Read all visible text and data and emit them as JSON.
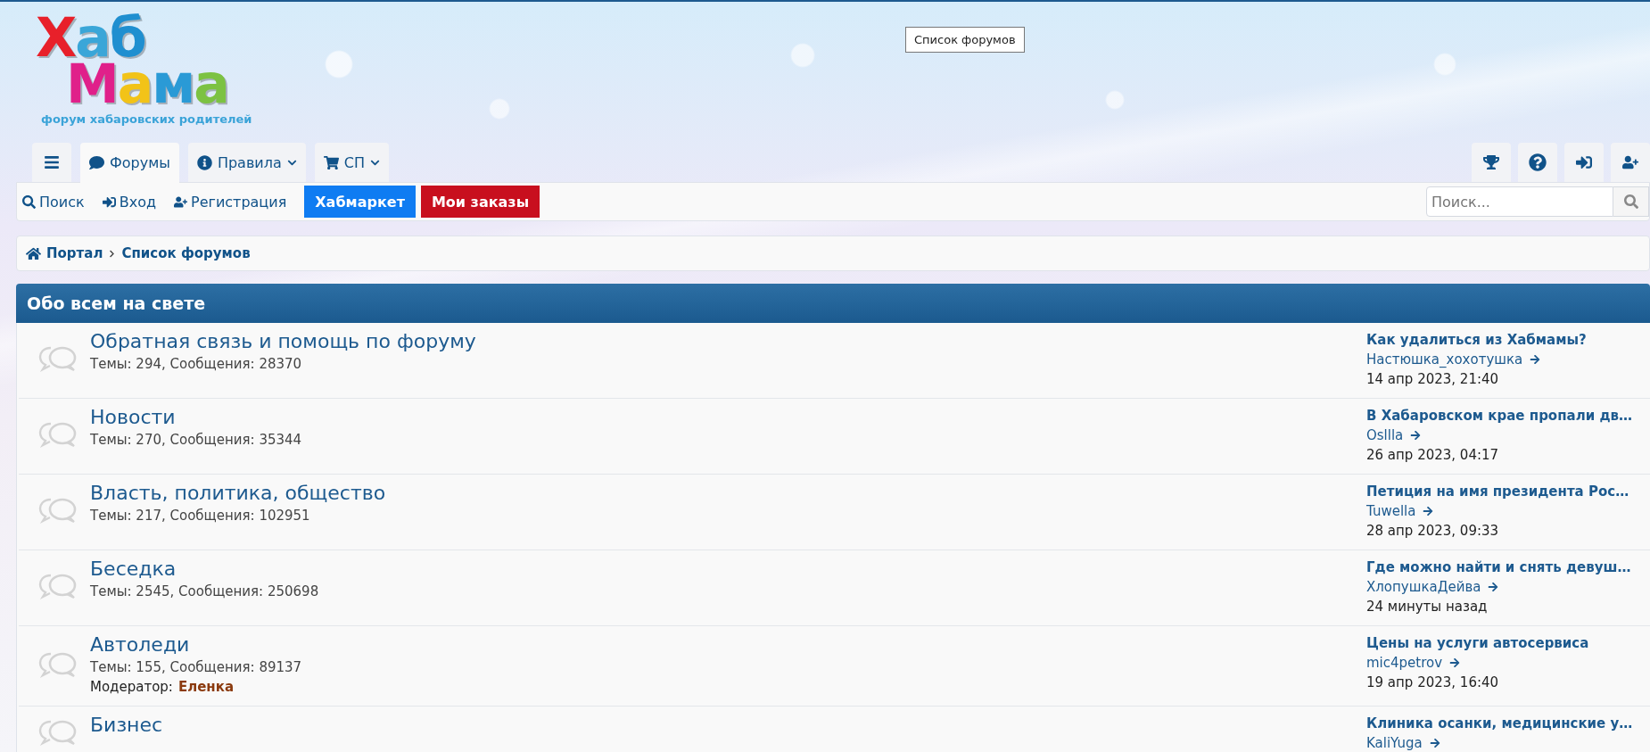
{
  "logo": {
    "lines": [
      "Хаб",
      "Мама"
    ],
    "subtitle": "форум хабаровских родителей"
  },
  "tooltip": "Список форумов",
  "tabs": [
    {
      "label": "Форумы",
      "selected": true,
      "dropdown": false
    },
    {
      "label": "Правила",
      "selected": false,
      "dropdown": true
    },
    {
      "label": "СП",
      "selected": false,
      "dropdown": true
    }
  ],
  "nav_links": [
    "Поиск",
    "Вход",
    "Регистрация"
  ],
  "nav_buttons": [
    {
      "label": "Хабмаркет",
      "kind": "blue"
    },
    {
      "label": "Мои заказы",
      "kind": "red"
    }
  ],
  "search": {
    "placeholder": "Поиск..."
  },
  "breadcrumbs": [
    "Портал",
    "Список форумов"
  ],
  "category": {
    "title": "Обо всем на свете"
  },
  "forums": [
    {
      "title": "Обратная связь и помощь по форуму",
      "stats": "Темы: 294, Сообщения: 28370",
      "last_post": {
        "title": "Как удалиться из Хабмамы?",
        "author": "Настюшка_хохотушка",
        "date": "14 апр 2023, 21:40"
      }
    },
    {
      "title": "Новости",
      "stats": "Темы: 270, Сообщения: 35344",
      "last_post": {
        "title": "В Хабаровском крае пропали дв…",
        "author": "Oslllа",
        "date": "26 апр 2023, 04:17"
      }
    },
    {
      "title": "Власть, политика, общество",
      "stats": "Темы: 217, Сообщения: 102951",
      "last_post": {
        "title": "Петиция на имя президента Рос…",
        "author": "Tuwella",
        "date": "28 апр 2023, 09:33"
      }
    },
    {
      "title": "Беседка",
      "stats": "Темы: 2545, Сообщения: 250698",
      "last_post": {
        "title": "Где можно найти и снять девуш…",
        "author": "ХлопушкаДейва",
        "date": "24 минуты назад"
      }
    },
    {
      "title": "Автоледи",
      "stats": "Темы: 155, Сообщения: 89137",
      "moderator": {
        "label": "Модератор:",
        "name": "Еленка"
      },
      "last_post": {
        "title": "Цены на услуги автосервиса",
        "author": "mic4petrov",
        "date": "19 апр 2023, 16:40"
      }
    },
    {
      "title": "Бизнес",
      "last_post": {
        "title": "Клиника осанки, медицинские у…",
        "author": "KaliYuga"
      }
    }
  ]
}
